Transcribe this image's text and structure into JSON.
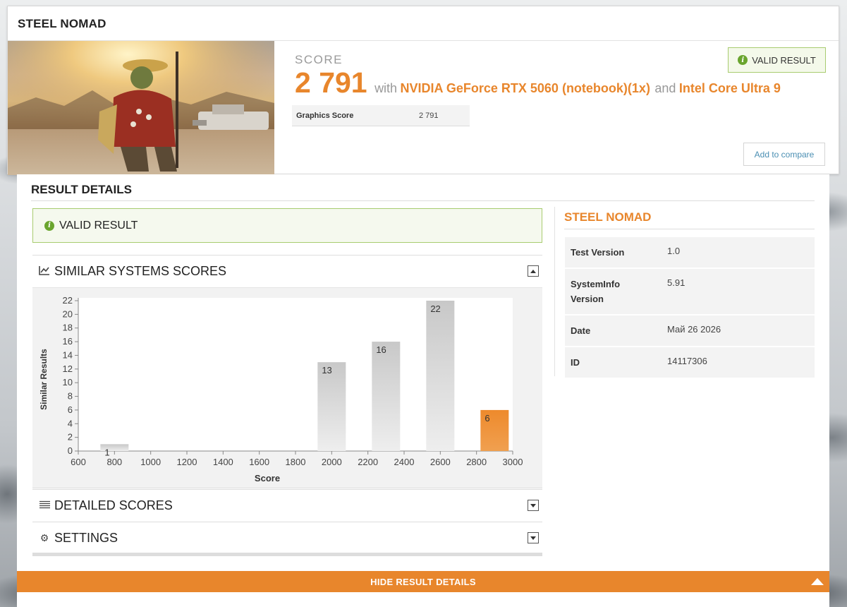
{
  "header": {
    "title": "STEEL NOMAD"
  },
  "score": {
    "label": "SCORE",
    "value": "2 791",
    "with_text": "with",
    "gpu": "NVIDIA GeForce RTX 5060 (notebook)(1x)",
    "and_text": "and",
    "cpu": "Intel Core Ultra 9",
    "graphics_label": "Graphics Score",
    "graphics_value": "2 791"
  },
  "badges": {
    "valid_result": "VALID RESULT",
    "add_to_compare": "Add to compare"
  },
  "details": {
    "title": "RESULT DETAILS",
    "valid": "VALID RESULT",
    "similar_title": "SIMILAR SYSTEMS SCORES",
    "detailed_title": "DETAILED SCORES",
    "settings_title": "SETTINGS"
  },
  "sidebar": {
    "title": "STEEL NOMAD",
    "rows": [
      {
        "key": "Test Version",
        "value": "1.0"
      },
      {
        "key": "SystemInfo Version",
        "value": "5.91"
      },
      {
        "key": "Date",
        "value": "Май 26 2026"
      },
      {
        "key": "ID",
        "value": "14117306"
      }
    ]
  },
  "footer": {
    "hide_label": "HIDE RESULT DETAILS"
  },
  "colors": {
    "accent": "#e8862c",
    "valid_border": "#a8cc70",
    "valid_icon": "#6aa52e",
    "bar_gray": "#d3d3d3"
  },
  "chart_data": {
    "type": "bar",
    "xlabel": "Score",
    "ylabel": "Similar Results",
    "xlim": [
      600,
      3000
    ],
    "ylim": [
      0,
      22
    ],
    "xticks": [
      600,
      800,
      1000,
      1200,
      1400,
      1600,
      1800,
      2000,
      2200,
      2400,
      2600,
      2800,
      3000
    ],
    "yticks": [
      0,
      2,
      4,
      6,
      8,
      10,
      12,
      14,
      16,
      18,
      20,
      22
    ],
    "bars": [
      {
        "x": 800,
        "value": 1,
        "highlight": false
      },
      {
        "x": 2000,
        "value": 13,
        "highlight": false
      },
      {
        "x": 2300,
        "value": 16,
        "highlight": false
      },
      {
        "x": 2600,
        "value": 22,
        "highlight": false
      },
      {
        "x": 2900,
        "value": 6,
        "highlight": true
      }
    ]
  }
}
